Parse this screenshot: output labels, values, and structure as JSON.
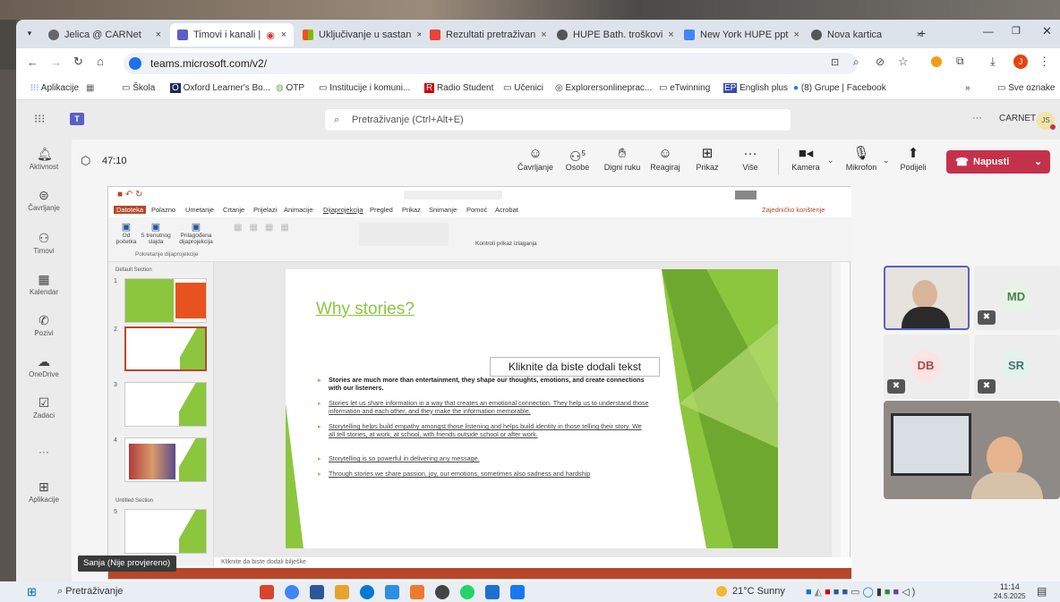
{
  "browser": {
    "tabs": [
      {
        "label": "Jelica @ CARNet",
        "x": "×"
      },
      {
        "label": "Timovi i kanali | ",
        "x": "×"
      },
      {
        "label": "Uključivanje u sastan",
        "x": "×"
      },
      {
        "label": "Rezultati pretraživan",
        "x": "×"
      },
      {
        "label": "HUPE Bath. troškovi",
        "x": "×"
      },
      {
        "label": "New York HUPE ppt",
        "x": "×"
      },
      {
        "label": "Nova kartica",
        "x": "×"
      }
    ],
    "new_tab": "+",
    "url": "teams.microsoft.com/v2/",
    "bookmarks": [
      "Aplikacije",
      "Škola",
      "Oxford Learner's Bo...",
      "OTP",
      "Institucije i komuni...",
      "Radio Student",
      "Učenici",
      "Explorersonlineprac...",
      "eTwinning",
      "English plus",
      "(8) Grupe | Facebook"
    ],
    "more": "»",
    "all_bookmarks": "Sve oznake"
  },
  "teams": {
    "search_placeholder": "Pretraživanje (Ctrl+Alt+E)",
    "more": "···",
    "org": "CARNET",
    "user_initials": "JS",
    "rail": [
      {
        "label": "Aktivnost",
        "icon": "bell-icon"
      },
      {
        "label": "Čavrljanje",
        "icon": "chat-icon"
      },
      {
        "label": "Timovi",
        "icon": "teams-icon"
      },
      {
        "label": "Kalendar",
        "icon": "calendar-icon"
      },
      {
        "label": "Pozivi",
        "icon": "phone-icon"
      },
      {
        "label": "OneDrive",
        "icon": "cloud-icon"
      },
      {
        "label": "Zadaci",
        "icon": "tasks-icon"
      },
      {
        "label": "···",
        "icon": "more-icon"
      },
      {
        "label": "Aplikacije",
        "icon": "apps-icon"
      }
    ]
  },
  "meeting": {
    "timer": "47:10",
    "controls": [
      {
        "label": "Čavrljanje",
        "icon": "chat-icon"
      },
      {
        "label": "Osobe",
        "icon": "people-icon",
        "badge": "5"
      },
      {
        "label": "Digni ruku",
        "icon": "hand-icon"
      },
      {
        "label": "Reagiraj",
        "icon": "smile-icon"
      },
      {
        "label": "Prikaz",
        "icon": "grid-icon"
      },
      {
        "label": "Više",
        "icon": "more-icon"
      },
      {
        "label": "Kamera",
        "icon": "camera-icon"
      },
      {
        "label": "Mikrofon",
        "icon": "mic-icon"
      },
      {
        "label": "Podijeli",
        "icon": "share-icon"
      }
    ],
    "leave": "Napusti",
    "participants": [
      {
        "initials": "MD",
        "color": "#e6f4e6",
        "text": "#4b7c4b"
      },
      {
        "initials": "DB",
        "color": "#fce4e4",
        "text": "#b04545"
      },
      {
        "initials": "SR",
        "color": "#e4f2ee",
        "text": "#3f7768"
      }
    ],
    "tooltip": "Sanja (Nije provjereno)"
  },
  "ppt": {
    "menu": [
      "Datoteka",
      "Polazno",
      "Umetanje",
      "Crtanje",
      "Prijelazi",
      "Animacije",
      "Dijaprojekcija",
      "Pregled",
      "Prikaz",
      "Snimanje",
      "Pomoć",
      "Acrobat"
    ],
    "comments": "Zajedničko korištenje",
    "ribbon": [
      "Od početka",
      "S trenutnog slajda",
      "Prilagođena dijaprojekcija"
    ],
    "ribbon_group": "Pokretanje dijaprojekcije",
    "ribbon_right": "Kontroli prikaz izlaganja",
    "sections": [
      "Default Section",
      "Untitled Section"
    ],
    "thumbs": [
      "1",
      "2",
      "3",
      "4",
      "5"
    ],
    "slide": {
      "title": "Why stories?",
      "placeholder": "Kliknite da biste dodali tekst",
      "bullets": [
        "Stories are much more than entertainment, they shape our thoughts, emotions, and create connections with our listeners.",
        "Stories let us share information in a way that creates an emotional connection. They help us to understand those information and each other, and they make the information memorable.",
        "Storytelling helps build empathy amongst those listening and helps build identity in those telling their story. We all tell stories, at work, at school, with friends outside school or after work.",
        "Storytelling is so powerful in delivering any message.",
        "Through stories we share passion, joy, our emotions, sometimes also sadness and hardship"
      ]
    },
    "notes": "Kliknite da biste dodali bilješke"
  },
  "taskbar": {
    "search": "Pretraživanje",
    "weather": "21°C Sunny",
    "time": "11:14",
    "date": "24.5.2025"
  }
}
